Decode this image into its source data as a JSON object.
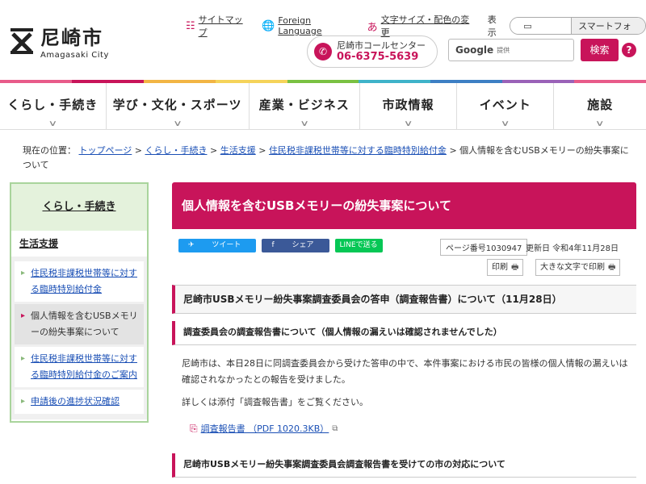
{
  "header": {
    "logo_title": "尼崎市",
    "logo_sub": "Amagasaki City",
    "sitemap": "サイトマップ",
    "foreign": "Foreign Language",
    "font_color": "文字サイズ・配色の変更",
    "display_label": "表示",
    "display_pc": "PC",
    "display_sp": "スマートフォン",
    "call_label": "尼崎市コールセンター",
    "call_number": "06-6375-5639",
    "search_google": "Google",
    "search_provided": "提供",
    "search_button": "検索",
    "help": "?"
  },
  "nav": [
    {
      "label": "くらし・手続き"
    },
    {
      "label": "学び・文化・スポーツ"
    },
    {
      "label": "産業・ビジネス"
    },
    {
      "label": "市政情報"
    },
    {
      "label": "イベント"
    },
    {
      "label": "施設"
    }
  ],
  "nav_colors": [
    "#e85b8a",
    "#c8145a",
    "#f2b544",
    "#f5d35a",
    "#7ac142",
    "#3fb3c9",
    "#3d7fc4",
    "#9a62b8",
    "#e85b8a"
  ],
  "breadcrumb": {
    "prefix": "現在の位置：",
    "items": [
      "トップページ",
      "くらし・手続き",
      "生活支援",
      "住民税非課税世帯等に対する臨時特別給付金"
    ],
    "current": "個人情報を含むUSBメモリーの紛失事案について",
    "sep": ">"
  },
  "sidebar": {
    "heading": "くらし・手続き",
    "subheading": "生活支援",
    "items": [
      {
        "label": "住民税非課税世帯等に対する臨時特別給付金"
      },
      {
        "label": "個人情報を含むUSBメモリーの紛失事案について"
      },
      {
        "label": "住民税非課税世帯等に対する臨時特別給付金のご案内"
      },
      {
        "label": "申請後の進捗状況確認"
      }
    ]
  },
  "main": {
    "title": "個人情報を含むUSBメモリーの紛失事案について",
    "share_tweet": "ツイート",
    "share_fb": "シェア",
    "share_line": "LINEで送る",
    "page_no": "ページ番号1030947",
    "updated": "更新日 令和4年11月28日",
    "print": "印刷",
    "print_large": "大きな文字で印刷",
    "h2_1": "尼崎市USBメモリー紛失事案調査委員会の答申（調査報告書）について（11月28日）",
    "h3_1": "調査委員会の調査報告書について（個人情報の漏えいは確認されませんでした）",
    "para1": "尼崎市は、本日28日に同調査委員会から受けた答申の中で、本件事案における市民の皆様の個人情報の漏えいは確認されなかったとの報告を受けました。",
    "para2": "詳しくは添付「調査報告書」をご覧ください。",
    "pdf_link": "調査報告書 （PDF 1020.3KB）",
    "h3_2": "尼崎市USBメモリー紛失事案調査委員会調査報告書を受けての市の対応について"
  }
}
